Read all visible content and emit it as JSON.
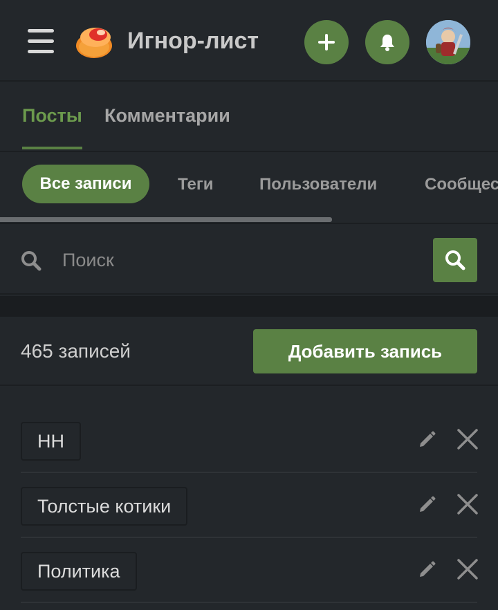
{
  "header": {
    "title": "Игнор-лист",
    "menu_icon": "hamburger-icon",
    "logo": "app-logo",
    "add_icon": "plus-icon",
    "notifications_icon": "bell-icon",
    "avatar": "user-avatar"
  },
  "main_tabs": [
    {
      "label": "Посты",
      "active": true
    },
    {
      "label": "Комментарии",
      "active": false
    }
  ],
  "sub_tabs": [
    {
      "label": "Все записи",
      "active": true
    },
    {
      "label": "Теги",
      "active": false
    },
    {
      "label": "Пользователи",
      "active": false
    },
    {
      "label": "Сообщества",
      "active": false
    }
  ],
  "search": {
    "placeholder": "Поиск",
    "value": ""
  },
  "summary": {
    "count_text": "465 записей",
    "add_button": "Добавить запись"
  },
  "entries": [
    {
      "label": "НН"
    },
    {
      "label": "Толстые котики"
    },
    {
      "label": "Политика"
    }
  ],
  "colors": {
    "background": "#23272b",
    "accent": "#5a8144",
    "accent_text": "#6c9a4d",
    "divider": "#1b1e21"
  }
}
